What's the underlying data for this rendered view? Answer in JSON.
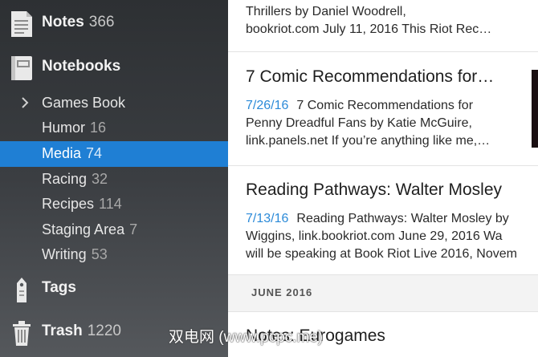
{
  "sidebar": {
    "notes": {
      "label": "Notes",
      "count": "366"
    },
    "notebooks": {
      "label": "Notebooks"
    },
    "items": [
      {
        "label": "Games Book",
        "count": ""
      },
      {
        "label": "Humor",
        "count": "16"
      },
      {
        "label": "Media",
        "count": "74"
      },
      {
        "label": "Racing",
        "count": "32"
      },
      {
        "label": "Recipes",
        "count": "114"
      },
      {
        "label": "Staging Area",
        "count": "7"
      },
      {
        "label": "Writing",
        "count": "53"
      }
    ],
    "tags": {
      "label": "Tags"
    },
    "trash": {
      "label": "Trash",
      "count": "1220"
    }
  },
  "notes_list": {
    "top_partial": {
      "lines": [
        "Thrillers by Daniel Woodrell,",
        "bookriot.com July 11, 2016 This Riot Rec…"
      ]
    },
    "notes": [
      {
        "title": "7 Comic Recommendations for…",
        "date": "7/26/16",
        "lines": [
          "7 Comic Recommendations for",
          "Penny Dreadful Fans by Katie McGuire,",
          "link.panels.net If you’re anything like me,…"
        ]
      },
      {
        "title": "Reading Pathways: Walter Mosley",
        "date": "7/13/16",
        "lines": [
          "Reading Pathways: Walter Mosley by",
          "Wiggins, link.bookriot.com June 29, 2016 Wa",
          "will be speaking at Book Riot Live 2016, Novem"
        ]
      }
    ],
    "section_header": "JUNE 2016",
    "bottom_partial_title": "Notes: Eurogames"
  },
  "watermark": "双电网 (www.pcpc.me)",
  "colors": {
    "selected": "#1f7fd4",
    "date": "#2b8ad8"
  },
  "icons": {
    "notes": "note-page-icon",
    "notebooks": "notebook-icon",
    "tags": "tag-icon",
    "trash": "trash-icon",
    "expand": "chevron-right-icon"
  }
}
